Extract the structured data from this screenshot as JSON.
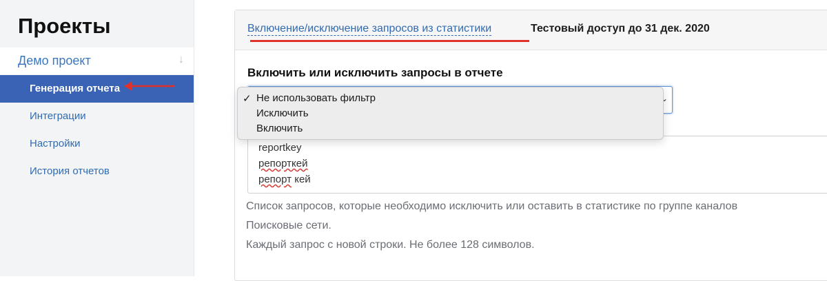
{
  "sidebar": {
    "title": "Проекты",
    "project": {
      "label": "Демо проект",
      "arrow": "↓"
    },
    "items": [
      {
        "label": "Генерация отчета",
        "active": true
      },
      {
        "label": "Интеграции"
      },
      {
        "label": "Настройки"
      },
      {
        "label": "История отчетов"
      }
    ]
  },
  "panel": {
    "header_link": "Включение/исключение запросов из статистики",
    "header_rest": "Тестовый доступ до 31 дек. 2020",
    "field_title": "Включить или исключить запросы в отчете",
    "select": {
      "chevron": "⌄"
    },
    "dropdown": {
      "check": "✓",
      "options": [
        "Не использовать фильтр",
        "Исключить",
        "Включить"
      ],
      "selected_index": 0
    },
    "textarea_lines": [
      "reportkey",
      "репорткей",
      "репорт кей"
    ],
    "help_lines": [
      "Список запросов, которые необходимо исключить или оставить в статистике по группе каналов",
      "Поисковые сети.",
      "Каждый запрос с новой строки. Не более 128 символов."
    ]
  },
  "colors": {
    "accent": "#3b63b5",
    "link": "#2f6bb3",
    "annotation": "#e0322b"
  },
  "icons": [
    "arrow-down-icon",
    "check-icon",
    "chevron-down-icon",
    "red-arrow-annotation"
  ]
}
